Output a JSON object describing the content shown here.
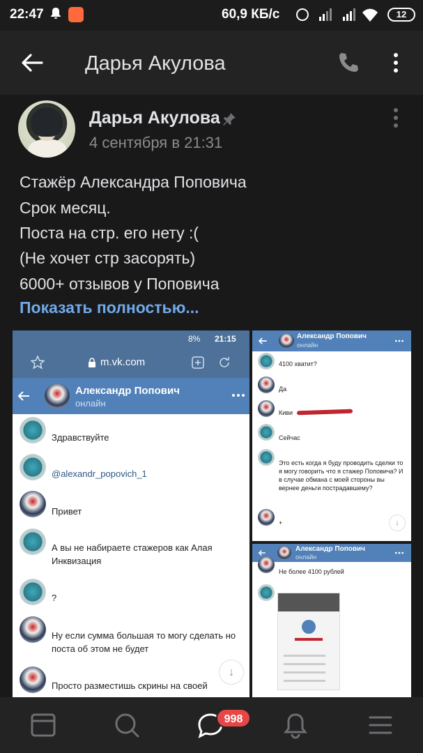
{
  "status_bar": {
    "time": "22:47",
    "network_speed": "60,9 КБ/с",
    "battery": "12"
  },
  "header": {
    "title": "Дарья Акулова"
  },
  "post": {
    "author": "Дарья Акулова",
    "date": "4 сентября в 21:31",
    "lines": [
      "Стажёр Александра Поповича",
      "Срок месяц.",
      "Поста на стр. его нету :(",
      "(Не хочет стр засорять)",
      "6000+ отзывов у Поповича"
    ],
    "show_more": "Показать полностью..."
  },
  "shot1": {
    "status_time": "21:15",
    "status_battery": "8%",
    "url": "m.vk.com",
    "chat_name": "Александр Попович",
    "chat_status": "онлайн",
    "messages": [
      "Здравствуйте",
      "@alexandr_popovich_1",
      "Привет",
      "А вы не набираете стажеров как Алая Инквизация",
      "?",
      "Ну если сумма большая то могу сделать но поста об этом не будет",
      "Просто разместишь скрины на своей"
    ]
  },
  "shot2": {
    "chat_name": "Александр Попович",
    "chat_status": "онлайн",
    "messages": [
      "4100 хватит?",
      "Да",
      "Киви",
      "Сейчас",
      "Это есть когда я буду проводить сделки то я могу говорить что я стажер Поповича? И в случае обмана с моей стороны вы вернее деньги пострадавшему?",
      "+"
    ]
  },
  "shot3": {
    "chat_name": "Александр Попович",
    "chat_status": "онлайн",
    "messages": [
      "Не более 4100 рублей"
    ]
  },
  "bottom_nav": {
    "messages_badge": "998"
  },
  "colors": {
    "accent": "#71aaeb",
    "vk_blue": "#5181b8",
    "badge": "#e64646",
    "background": "#19191a"
  }
}
